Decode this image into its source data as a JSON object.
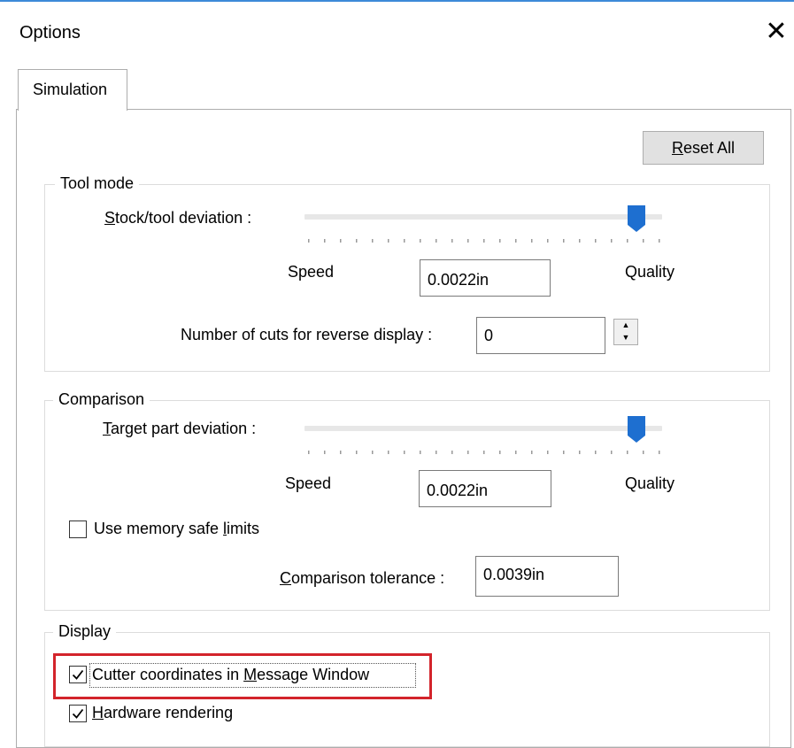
{
  "window": {
    "title": "Options"
  },
  "icons": {
    "close": "close-icon",
    "spin_up": "chevron-up-icon",
    "spin_down": "chevron-down-icon",
    "check": "checkmark-icon"
  },
  "tabs": [
    {
      "label": "Simulation",
      "selected": true
    }
  ],
  "reset_button": {
    "label": "Reset All",
    "mnemonic": "R",
    "rest": "eset All"
  },
  "tool_mode": {
    "legend": "Tool mode",
    "deviation_label": {
      "mnemonic": "S",
      "rest": "tock/tool deviation :"
    },
    "slider_value": 0.95,
    "speed_label": "Speed",
    "quality_label": "Quality",
    "deviation_value": "0.0022in",
    "cuts_label": "Number of cuts for reverse display :",
    "cuts_value": "0"
  },
  "comparison": {
    "legend": "Comparison",
    "deviation_label": {
      "mnemonic": "T",
      "rest": "arget part deviation :"
    },
    "slider_value": 0.95,
    "speed_label": "Speed",
    "quality_label": "Quality",
    "deviation_value": "0.0022in",
    "memory_checkbox": {
      "checked": false,
      "pre": "Use memory safe ",
      "mnemonic": "l",
      "post": "imits"
    },
    "tolerance_label": {
      "mnemonic": "C",
      "rest": "omparison tolerance :"
    },
    "tolerance_value": "0.0039in"
  },
  "display": {
    "legend": "Display",
    "cutter_checkbox": {
      "checked": true,
      "pre": "Cutter coordinates in ",
      "mnemonic": "M",
      "post": "essage Window"
    },
    "hardware_checkbox": {
      "checked": true,
      "pre": "",
      "mnemonic": "H",
      "post": "ardware rendering"
    }
  },
  "colors": {
    "accent": "#3c8ad8",
    "highlight": "#d3242b",
    "thumb": "#1e6fd0"
  }
}
